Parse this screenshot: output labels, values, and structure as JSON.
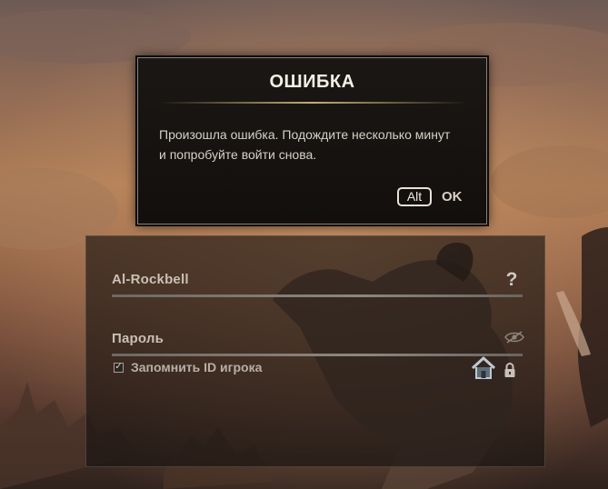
{
  "dialog": {
    "title": "ОШИБКА",
    "message": "Произошла ошибка. Подождите несколько минут и попробуйте войти снова.",
    "alt_key_label": "Alt",
    "ok_label": "OK"
  },
  "login": {
    "account_value": "Al-Rockbell",
    "help_glyph": "?",
    "password_placeholder": "Пароль",
    "remember_checked": true,
    "remember_label": "Запомнить ID игрока"
  },
  "icons": {
    "help": "question-mark-icon",
    "show_password": "eye-slash-icon",
    "home": "home-icon",
    "lock": "lock-icon"
  }
}
